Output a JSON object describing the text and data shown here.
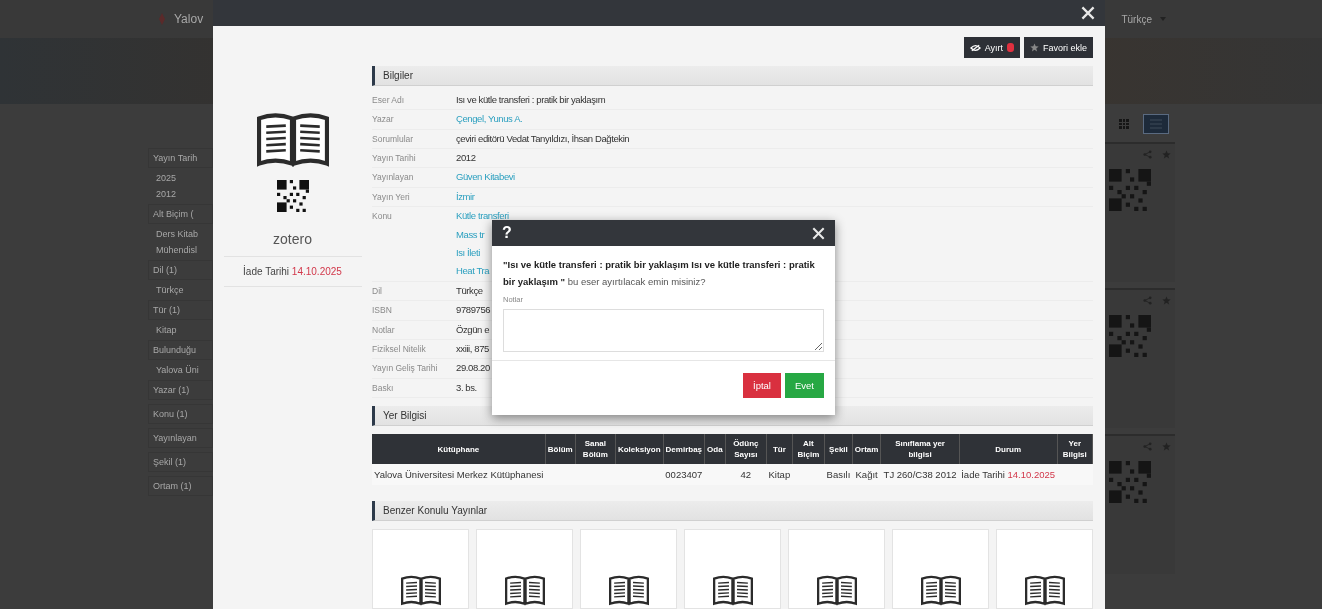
{
  "background": {
    "brand": "Yalov",
    "language": "Türkçe",
    "facets": [
      {
        "kind": "header",
        "label": "Yayın Tarih"
      },
      {
        "kind": "value",
        "label": "2025"
      },
      {
        "kind": "value",
        "label": "2012"
      },
      {
        "kind": "header",
        "label": "Alt Biçim ("
      },
      {
        "kind": "value",
        "label": "Ders Kitab"
      },
      {
        "kind": "value",
        "label": "Mühendisl"
      },
      {
        "kind": "header",
        "label": "Dil (1)"
      },
      {
        "kind": "value",
        "label": "Türkçe"
      },
      {
        "kind": "header",
        "label": "Tür (1)"
      },
      {
        "kind": "value",
        "label": "Kitap"
      },
      {
        "kind": "header",
        "label": "Bulunduğu"
      },
      {
        "kind": "value",
        "label": "Yalova Üni"
      },
      {
        "kind": "header",
        "label": "Yazar (1)"
      },
      {
        "kind": "header",
        "label": "Konu (1)"
      },
      {
        "kind": "header",
        "label": "Yayınlayan"
      },
      {
        "kind": "header",
        "label": "Şekil (1)"
      },
      {
        "kind": "header",
        "label": "Ortam (1)"
      }
    ],
    "view_modes": [
      {
        "kind": "grid",
        "selected": false
      },
      {
        "kind": "list",
        "selected": true
      }
    ]
  },
  "modal": {
    "actions": [
      {
        "kind": "reserve",
        "label": "Ayırt"
      },
      {
        "kind": "favorite",
        "label": "Favori ekle"
      }
    ],
    "side": {
      "zotero": "zotero",
      "due_label": "İade Tarihi",
      "due_date": "14.10.2025"
    },
    "info": {
      "title": "Bilgiler",
      "rows": [
        {
          "label": "Eser Adı",
          "values": [
            "Isı ve kütle transferi : pratik bir yaklaşım"
          ],
          "link": false
        },
        {
          "label": "Yazar",
          "values": [
            "Çengel, Yunus A."
          ],
          "link": true
        },
        {
          "label": "Sorumlular",
          "values": [
            "çeviri editörü Vedat Tanyıldızı, İhsan Dağtekin"
          ],
          "link": false
        },
        {
          "label": "Yayın Tarihi",
          "values": [
            "2012"
          ],
          "link": false
        },
        {
          "label": "Yayınlayan",
          "values": [
            "Güven Kitabevi"
          ],
          "link": true
        },
        {
          "label": "Yayın Yeri",
          "values": [
            "İzmir"
          ],
          "link": true
        },
        {
          "label": "Konu",
          "values": [
            "Kütle transferi",
            "Mass tr",
            "Isı İleti",
            "Heat Tra"
          ],
          "link": true
        },
        {
          "label": "Dil",
          "values": [
            "Türkçe"
          ],
          "link": false
        },
        {
          "label": "ISBN",
          "values": [
            "9789756"
          ],
          "link": false
        },
        {
          "label": "Notlar",
          "values": [
            "Özgün e"
          ],
          "link": false
        },
        {
          "label": "Fiziksel Nitelik",
          "values": [
            "xxiii, 875"
          ],
          "link": false
        },
        {
          "label": "Yayın Geliş Tarihi",
          "values": [
            "29.08.20"
          ],
          "link": false
        },
        {
          "label": "Baskı",
          "values": [
            "3. bs."
          ],
          "link": false
        }
      ]
    },
    "location": {
      "title": "Yer Bilgisi",
      "columns": [
        "Kütüphane",
        "Bölüm",
        "Sanal Bölüm",
        "Koleksiyon",
        "Demirbaş",
        "Oda",
        "Ödünç Sayısı",
        "Tür",
        "Alt Biçim",
        "Şekil",
        "Ortam",
        "Sınıflama yer bilgisi",
        "Durum",
        "Yer Bilgisi"
      ],
      "rows": [
        {
          "cells": [
            "Yalova Üniversitesi Merkez Kütüphanesi",
            null,
            null,
            null,
            "0023407",
            null,
            "42",
            "Kitap",
            null,
            "Basılı",
            "Kağıt",
            "TJ 260/C38 2012",
            {
              "label": "İade Tarihi",
              "date": "14.10.2025"
            },
            null
          ]
        }
      ]
    },
    "similar": {
      "title": "Benzer Konulu Yayınlar"
    }
  },
  "dialog": {
    "icon": "?",
    "message": "**\"Isı ve kütle transferi : pratik bir yaklaşım Isı ve kütle transferi : pratik bir yaklaşım \"** bu eser ayırtılacak emin misiniz?",
    "notes_label": "Notlar",
    "buttons": [
      {
        "kind": "cancel",
        "label": "İptal"
      },
      {
        "kind": "confirm",
        "label": "Evet"
      }
    ]
  }
}
